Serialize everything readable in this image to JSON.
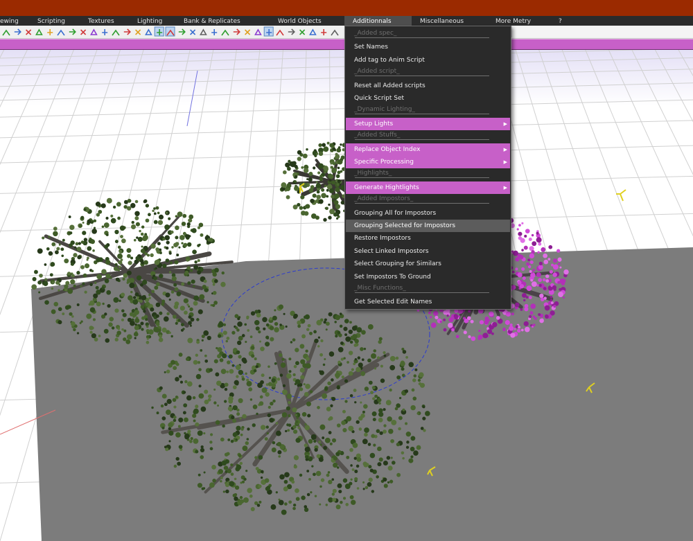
{
  "menubar": {
    "items": [
      {
        "label": "ewing"
      },
      {
        "label": "Scripting"
      },
      {
        "label": "Textures"
      },
      {
        "label": "Lighting"
      },
      {
        "label": "Bank & Replicates"
      },
      {
        "label": "World Objects"
      },
      {
        "label": "Additionnals"
      },
      {
        "label": "Miscellaneous"
      },
      {
        "label": "More Metry"
      },
      {
        "label": "?"
      }
    ]
  },
  "dropdown": {
    "items": [
      {
        "label": "_Added spec_",
        "kind": "separator"
      },
      {
        "label": "Set Names",
        "kind": "item"
      },
      {
        "label": "Add tag to Anim Script",
        "kind": "item"
      },
      {
        "label": "_Added script_",
        "kind": "separator"
      },
      {
        "label": "Reset all Added scripts",
        "kind": "item"
      },
      {
        "label": "Quick Script Set",
        "kind": "item"
      },
      {
        "label": "_Dynamic Lighting_",
        "kind": "separator"
      },
      {
        "label": "Setup Lights",
        "kind": "submenu"
      },
      {
        "label": "_Added Stuffs_",
        "kind": "separator"
      },
      {
        "label": "Replace Object Index",
        "kind": "submenu"
      },
      {
        "label": "Specific Processing",
        "kind": "submenu"
      },
      {
        "label": "_Highlights_",
        "kind": "separator"
      },
      {
        "label": "Generate Hightlights",
        "kind": "submenu"
      },
      {
        "label": "_Added Impostors_",
        "kind": "separator"
      },
      {
        "label": "Grouping All for Impostors",
        "kind": "item"
      },
      {
        "label": "Grouping Selected for Impostors",
        "kind": "item",
        "highlighted": true
      },
      {
        "label": "Restore Impostors",
        "kind": "item"
      },
      {
        "label": "Select Linked Impostors",
        "kind": "item"
      },
      {
        "label": "Select Grouping for Similars",
        "kind": "item"
      },
      {
        "label": "Set Impostors To Ground",
        "kind": "item"
      },
      {
        "label": "_Misc Functions_",
        "kind": "separator"
      },
      {
        "label": "Get Selected Edit Names",
        "kind": "item"
      }
    ]
  },
  "colors": {
    "titlebar": "#9b2a00",
    "menubar": "#2b2b2b",
    "accent_magenta": "#c760c8",
    "menu_bg": "#2a2a2a",
    "menu_highlight": "#5c5c5c",
    "ground": "#7c7c7c",
    "sky_band": "#e4e0f6",
    "grid_line": "#d0d0d0",
    "foliage": "#3e5a26"
  },
  "icons": {
    "submenu_arrow": "submenu-arrow-icon",
    "toolbar": "toolbar-tool-icons"
  }
}
